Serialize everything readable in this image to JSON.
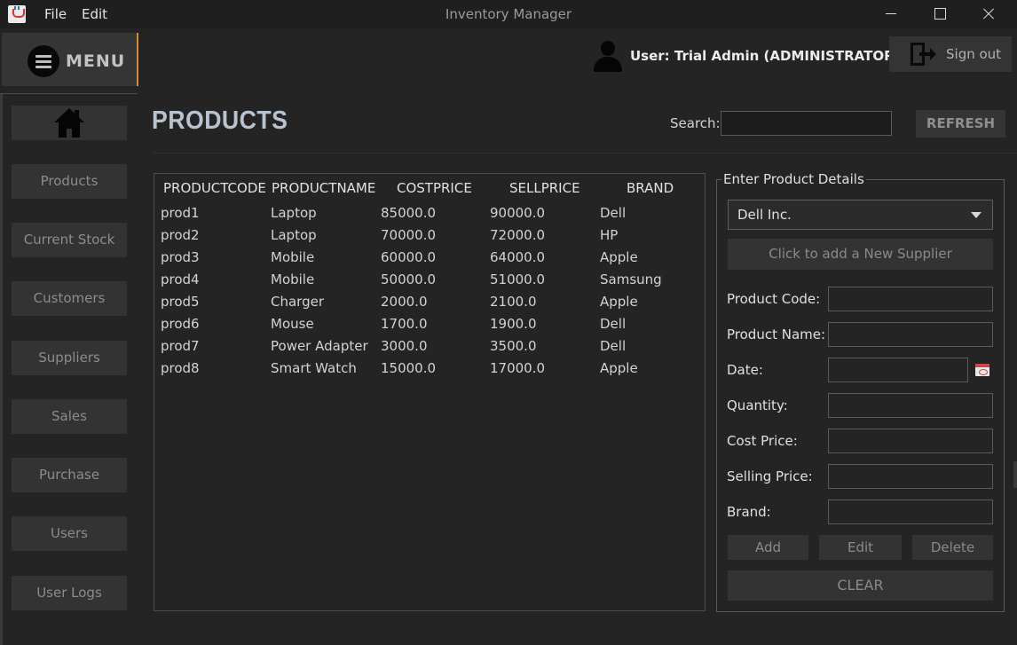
{
  "titlebar": {
    "menus": [
      "File",
      "Edit"
    ],
    "title": "Inventory Manager"
  },
  "header": {
    "menu_label": "MENU",
    "user_label": "User: Trial Admin (ADMINISTRATOR)",
    "signout_label": "Sign out"
  },
  "sidebar": {
    "items": [
      "Products",
      "Current Stock",
      "Customers",
      "Suppliers",
      "Sales",
      "Purchase",
      "Users",
      "User Logs"
    ]
  },
  "page": {
    "title": "PRODUCTS",
    "search_label": "Search:",
    "search_value": "",
    "refresh_label": "REFRESH"
  },
  "table": {
    "columns": [
      "PRODUCTCODE",
      "PRODUCTNAME",
      "COSTPRICE",
      "SELLPRICE",
      "BRAND"
    ],
    "rows": [
      [
        "prod1",
        "Laptop",
        "85000.0",
        "90000.0",
        "Dell"
      ],
      [
        "prod2",
        "Laptop",
        "70000.0",
        "72000.0",
        "HP"
      ],
      [
        "prod3",
        "Mobile",
        "60000.0",
        "64000.0",
        "Apple"
      ],
      [
        "prod4",
        "Mobile",
        "50000.0",
        "51000.0",
        "Samsung"
      ],
      [
        "prod5",
        "Charger",
        "2000.0",
        "2100.0",
        "Apple"
      ],
      [
        "prod6",
        "Mouse",
        "1700.0",
        "1900.0",
        "Dell"
      ],
      [
        "prod7",
        "Power Adapter",
        "3000.0",
        "3500.0",
        "Dell"
      ],
      [
        "prod8",
        "Smart Watch",
        "15000.0",
        "17000.0",
        "Apple"
      ]
    ]
  },
  "form": {
    "legend": "Enter Product Details",
    "supplier_selected": "Dell Inc.",
    "add_supplier_label": "Click to add a New Supplier",
    "fields": {
      "product_code": "Product Code:",
      "product_name": "Product Name:",
      "date": "Date:",
      "quantity": "Quantity:",
      "cost_price": "Cost Price:",
      "selling_price": "Selling Price:",
      "brand": "Brand:"
    },
    "buttons": {
      "add": "Add",
      "edit": "Edit",
      "delete": "Delete",
      "clear": "CLEAR"
    }
  }
}
